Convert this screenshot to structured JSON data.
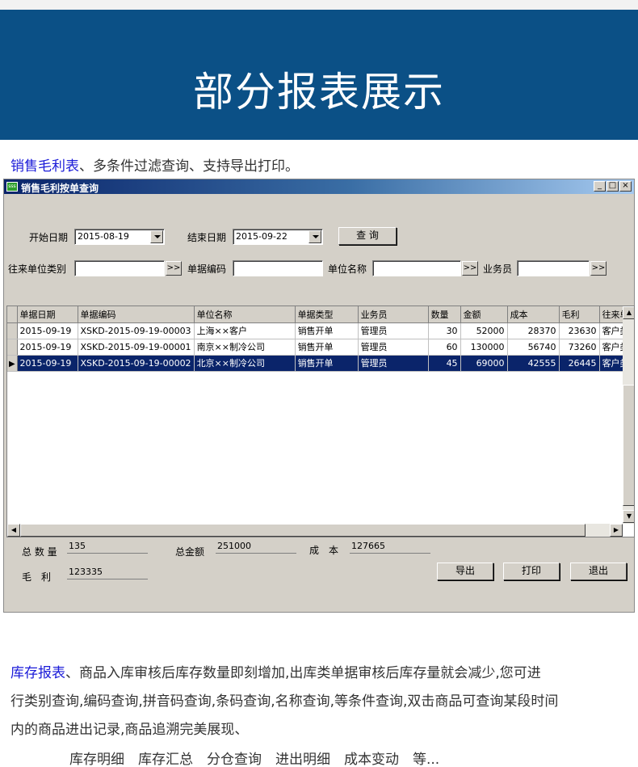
{
  "banner": {
    "title": "部分报表展示"
  },
  "section1": {
    "link": "销售毛利表",
    "text": "、多条件过滤查询、支持导出打印。"
  },
  "window": {
    "title": "销售毛利按单查询",
    "min": "_",
    "max": "□",
    "close": "×",
    "filters": {
      "start_label": "开始日期",
      "start_value": "2015-08-19",
      "end_label": "结束日期",
      "end_value": "2015-09-22",
      "query_button": "查 询",
      "partner_type_label": "往来单位类别",
      "doc_no_label": "单据编码",
      "unit_name_label": "单位名称",
      "salesman_label": "业务员",
      "browse": ">>"
    },
    "table": {
      "columns": [
        "单据日期",
        "单据编码",
        "单位名称",
        "单据类型",
        "业务员",
        "数量",
        "金额",
        "成本",
        "毛利",
        "往来单"
      ],
      "rows": [
        [
          "2015-09-19",
          "XSKD-2015-09-19-00003",
          "上海××客户",
          "销售开单",
          "管理员",
          "30",
          "52000",
          "28370",
          "23630",
          "客户类"
        ],
        [
          "2015-09-19",
          "XSKD-2015-09-19-00001",
          "南京××制冷公司",
          "销售开单",
          "管理员",
          "60",
          "130000",
          "56740",
          "73260",
          "客户类"
        ],
        [
          "2015-09-19",
          "XSKD-2015-09-19-00002",
          "北京××制冷公司",
          "销售开单",
          "管理员",
          "45",
          "69000",
          "42555",
          "26445",
          "客户类"
        ]
      ],
      "selected_row": 2
    },
    "summary": {
      "qty_label": "总 数 量",
      "qty_value": "135",
      "amount_label": "总金额",
      "amount_value": "251000",
      "cost_label": "成　本",
      "cost_value": "127665",
      "profit_label": "毛　利",
      "profit_value": "123335"
    },
    "buttons": {
      "export": "导出",
      "print": "打印",
      "exit": "退出"
    }
  },
  "section2": {
    "link": "库存报表",
    "line1": "、商品入库审核后库存数量即刻增加,出库类单据审核后库存量就会减少,您可进",
    "line2": "行类别查询,编码查询,拼音码查询,条码查询,名称查询,等条件查询,双击商品可查询某段时间",
    "line3": "内的商品进出记录,商品追溯完美展现、",
    "line4": "库存明细　库存汇总　分仓查询　进出明细　成本变动　等..."
  },
  "colors": {
    "banner_bg": "#0b5086",
    "link": "#1a1ad8",
    "selection": "#0a246a"
  }
}
